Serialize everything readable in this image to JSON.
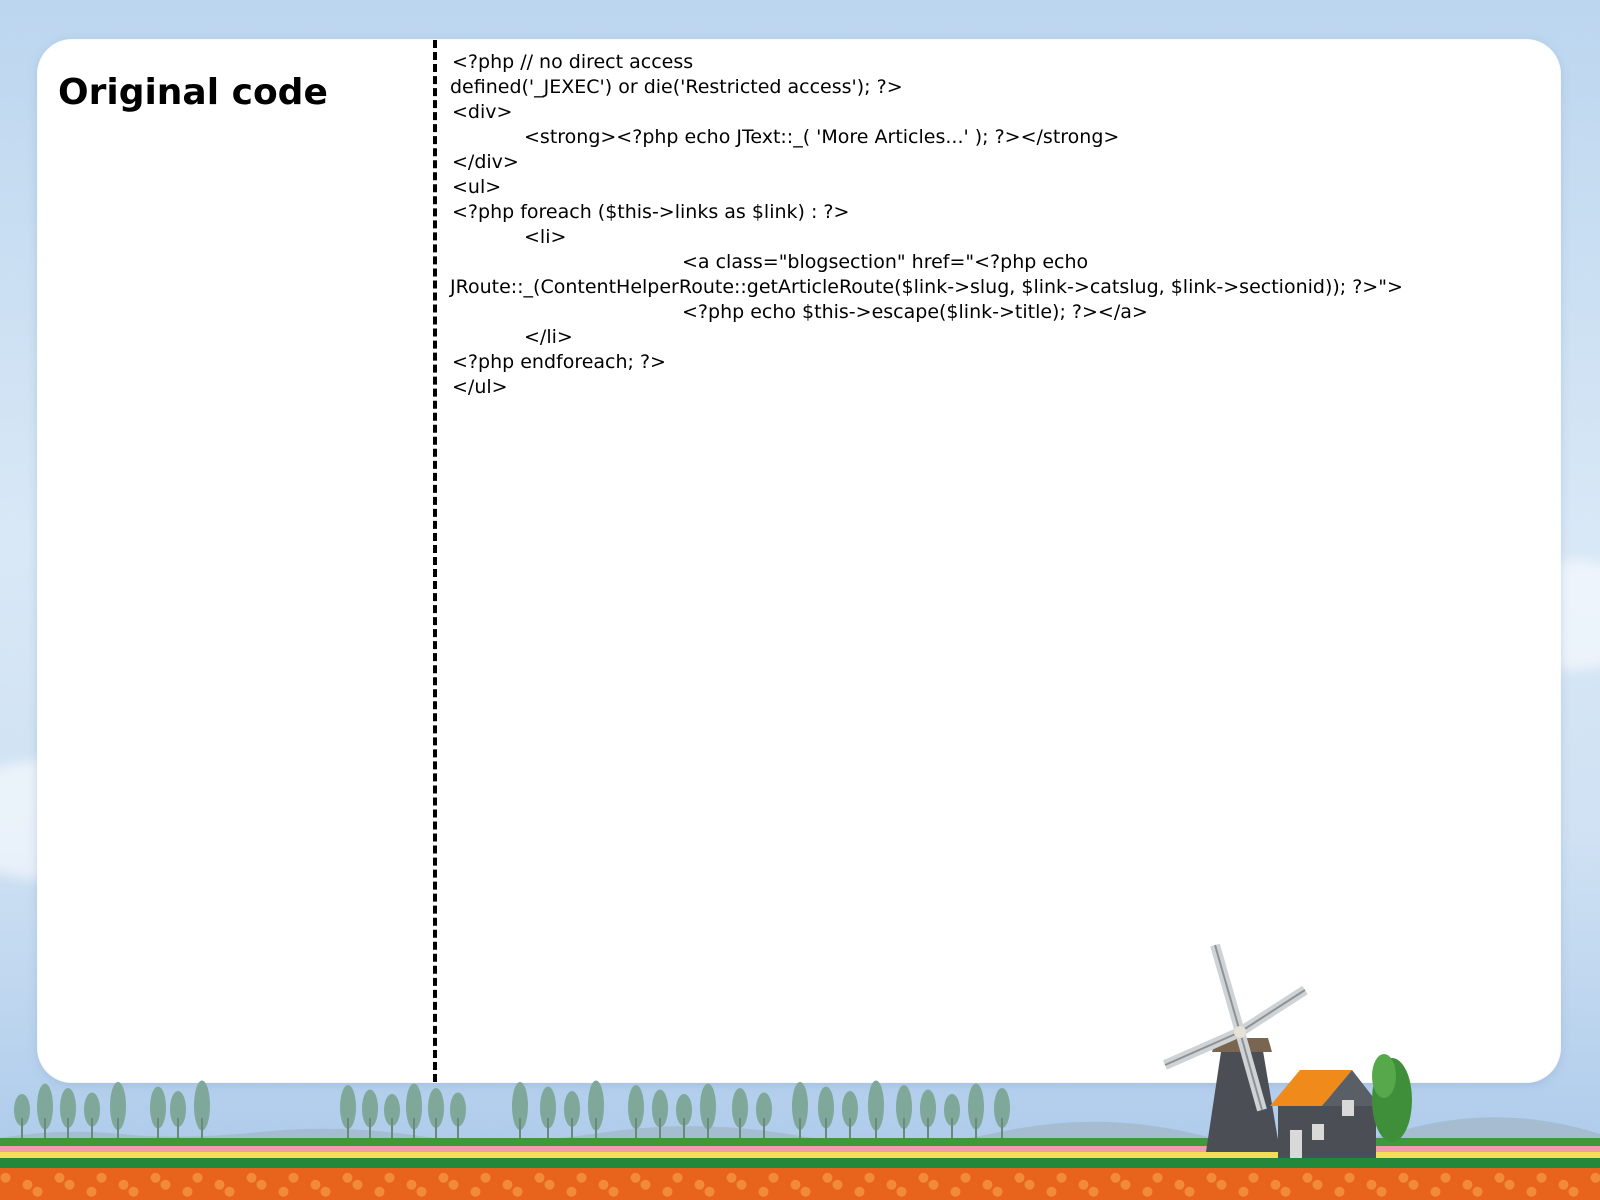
{
  "slide": {
    "title": "Original code",
    "code_lines": [
      {
        "indent": "",
        "text": "<?php // no direct access"
      },
      {
        "indent": "",
        "text": "defined('_JEXEC') or die('Restricted access'); ?>"
      },
      {
        "indent": "",
        "text": "<div>"
      },
      {
        "indent": "\t",
        "text": "<strong><?php echo JText::_( 'More Articles...' ); ?></strong>"
      },
      {
        "indent": "",
        "text": "</div>"
      },
      {
        "indent": "",
        "text": "<ul>"
      },
      {
        "indent": "",
        "text": "<?php foreach ($this->links as $link) : ?>"
      },
      {
        "indent": "\t",
        "text": "<li>"
      },
      {
        "indent": "\t\t\t",
        "text": "<a class=\"blogsection\" href=\"<?php echo"
      },
      {
        "indent": "",
        "text": "JRoute::_(ContentHelperRoute::getArticleRoute($link->slug, $link->catslug, $link->sectionid)); ?>\">"
      },
      {
        "indent": "\t\t\t",
        "text": "<?php echo $this->escape($link->title); ?></a>"
      },
      {
        "indent": "\t",
        "text": "</li>"
      },
      {
        "indent": "",
        "text": "<?php endforeach; ?>"
      },
      {
        "indent": "",
        "text": "</ul>"
      }
    ]
  },
  "colors": {
    "sky": "#bcd6ef",
    "card": "#ffffff",
    "grass": "#2e8b3a",
    "tulips": "#e8631c",
    "roof": "#f08a1a",
    "house": "#4b4f55"
  }
}
